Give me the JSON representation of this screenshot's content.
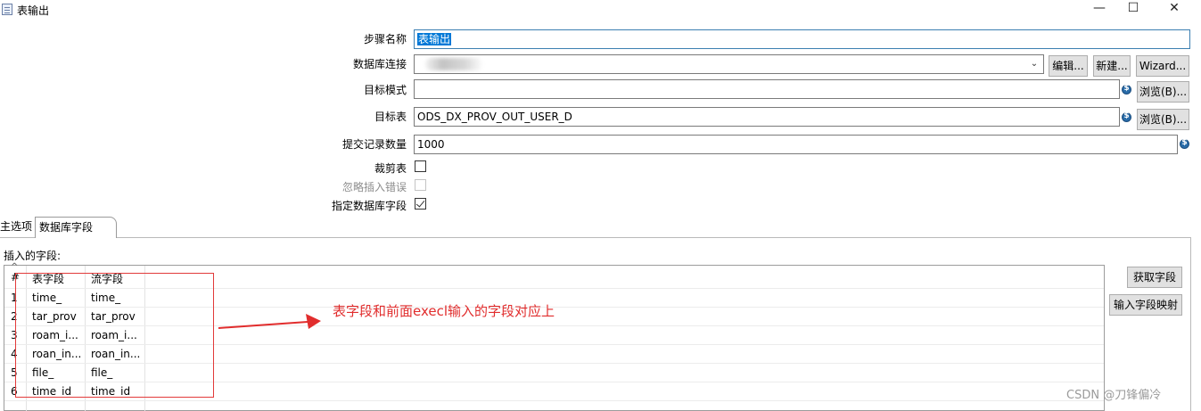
{
  "window": {
    "title": "表输出",
    "controls": {
      "minimize": "—",
      "maximize": "☐",
      "close": "✕"
    }
  },
  "form": {
    "step_name": {
      "label": "步骤名称",
      "value": "表输出"
    },
    "db_connection": {
      "label": "数据库连接",
      "edit_button": "编辑...",
      "new_button": "新建...",
      "wizard_button": "Wizard..."
    },
    "target_schema": {
      "label": "目标模式",
      "value": "",
      "browse_button": "浏览(B)..."
    },
    "target_table": {
      "label": "目标表",
      "value": "ODS_DX_PROV_OUT_USER_D",
      "browse_button": "浏览(B)..."
    },
    "commit_size": {
      "label": "提交记录数量",
      "value": "1000"
    },
    "truncate_table": {
      "label": "裁剪表",
      "checked": false
    },
    "ignore_insert_errors": {
      "label": "忽略插入错误",
      "checked": false,
      "disabled": true
    },
    "specify_db_fields": {
      "label": "指定数据库字段",
      "checked": true
    }
  },
  "tabs": [
    {
      "label": "主选项",
      "active": false
    },
    {
      "label": "数据库字段",
      "active": true
    }
  ],
  "fields_section": {
    "label": "插入的字段:",
    "sort_icon": "^",
    "columns": [
      "#",
      "表字段",
      "流字段"
    ],
    "rows": [
      {
        "num": "1",
        "table_field": "time_",
        "stream_field": "time_"
      },
      {
        "num": "2",
        "table_field": "tar_prov",
        "stream_field": "tar_prov"
      },
      {
        "num": "3",
        "table_field": "roam_i...",
        "stream_field": "roam_i..."
      },
      {
        "num": "4",
        "table_field": "roan_in...",
        "stream_field": "roan_in..."
      },
      {
        "num": "5",
        "table_field": "file_",
        "stream_field": "file_"
      },
      {
        "num": "6",
        "table_field": "time_id",
        "stream_field": "time_id"
      }
    ],
    "get_fields_button": "获取字段",
    "map_fields_button": "输入字段映射"
  },
  "annotation": {
    "text": "表字段和前面execl输入的字段对应上",
    "color": "#e12d2d"
  },
  "watermark": "CSDN @刀锋偏冷"
}
